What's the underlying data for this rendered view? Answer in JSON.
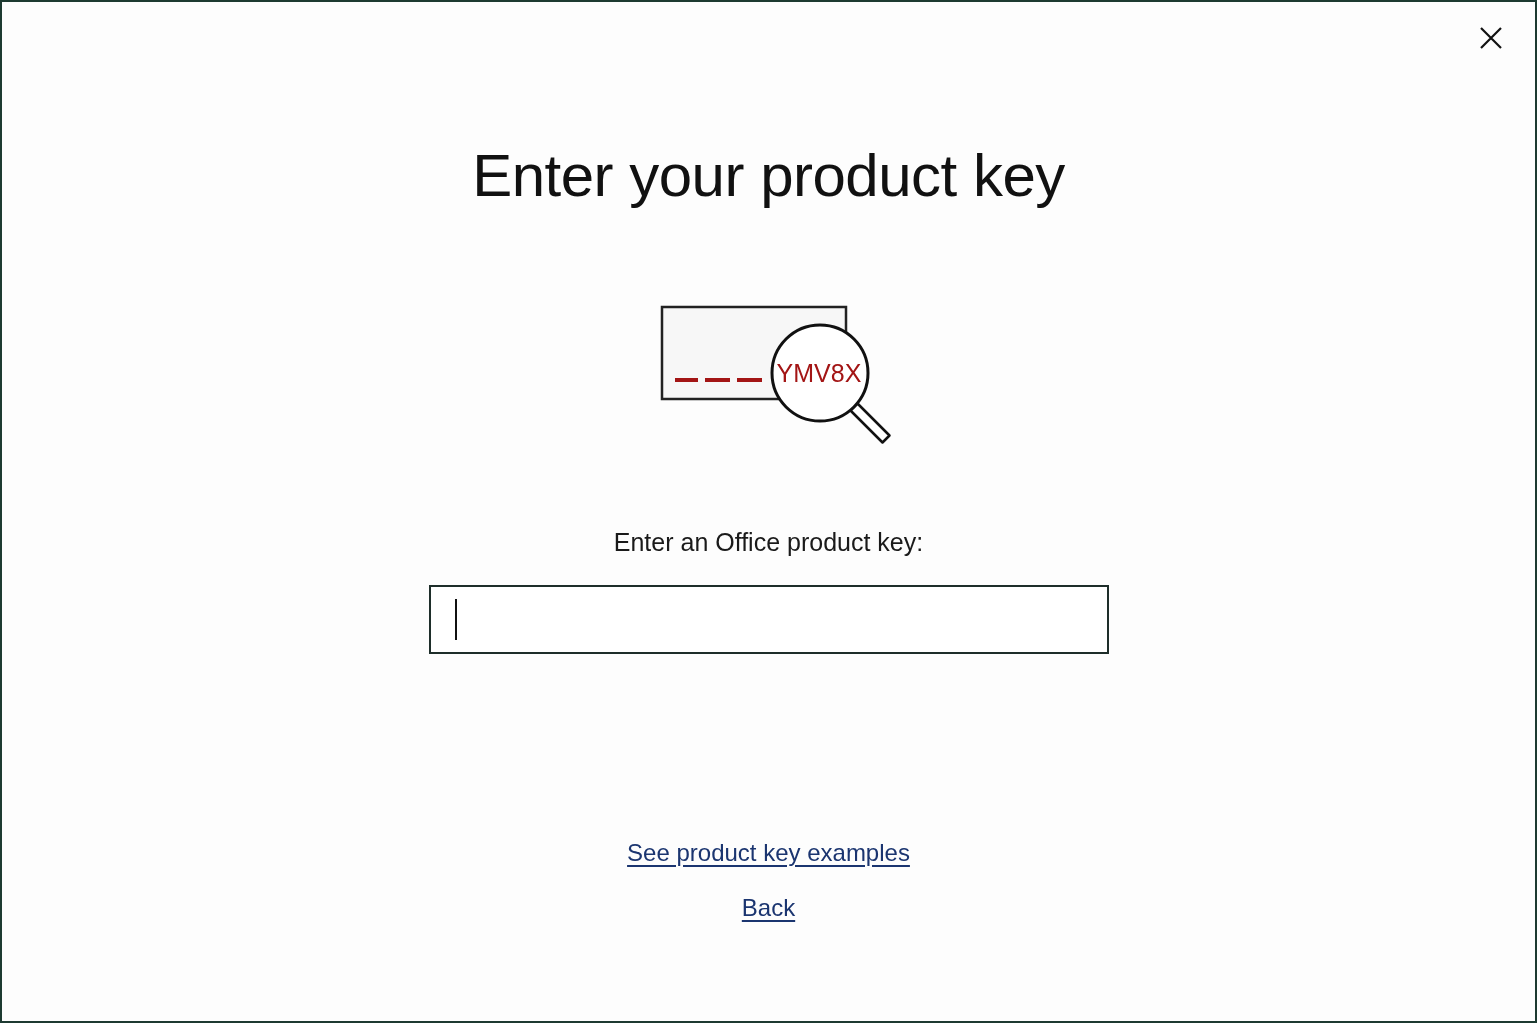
{
  "title": "Enter your product key",
  "illustration": {
    "key_fragment": "YMV8X"
  },
  "key_input": {
    "label": "Enter an Office product key:",
    "focused": true
  },
  "links": [
    {
      "text": "See product key examples"
    },
    {
      "text": "Back"
    }
  ]
}
